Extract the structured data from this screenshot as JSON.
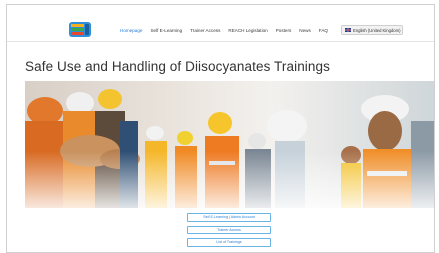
{
  "nav": {
    "links": [
      "Homepage",
      "Self E-Learning",
      "Trainer Access",
      "REACH Legislation",
      "Posters",
      "News",
      "FAQ"
    ],
    "active_index": 0,
    "language": "English (United Kingdom)"
  },
  "page": {
    "title": "Safe Use and Handling of Diisocyanates Trainings"
  },
  "buttons": [
    "Self E-Learning | Admin Account",
    "Trainer Access",
    "List of Trainings"
  ],
  "colors": {
    "accent": "#2a7fd4",
    "button_border": "#6ab4e6"
  }
}
